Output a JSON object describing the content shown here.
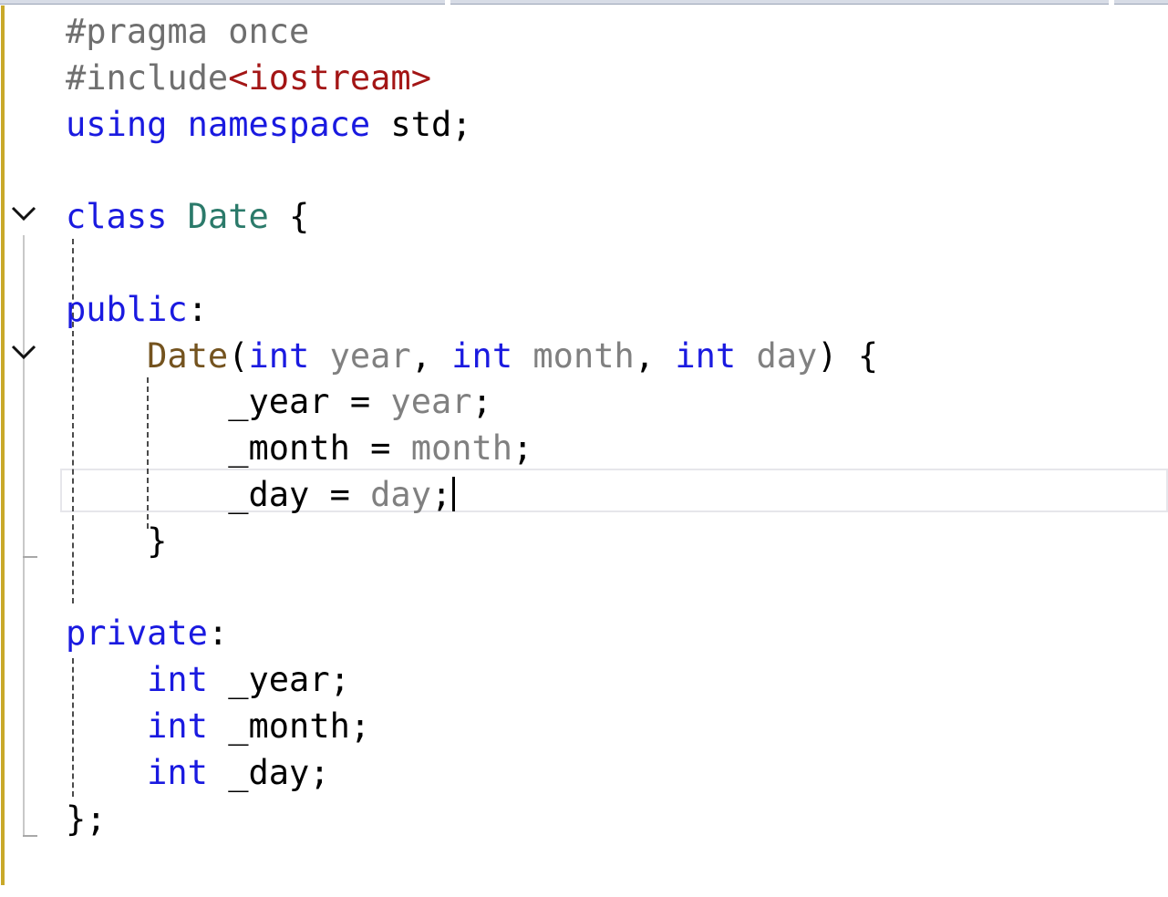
{
  "editor": {
    "language": "C++",
    "lines": [
      {
        "tokens": [
          {
            "t": "#pragma once",
            "c": "pre"
          }
        ]
      },
      {
        "tokens": [
          {
            "t": "#include",
            "c": "pre"
          },
          {
            "t": "<iostream>",
            "c": "inc"
          }
        ]
      },
      {
        "tokens": [
          {
            "t": "using",
            "c": "kw"
          },
          {
            "t": " ",
            "c": "punc"
          },
          {
            "t": "namespace",
            "c": "kw"
          },
          {
            "t": " std;",
            "c": "punc"
          }
        ]
      },
      {
        "tokens": []
      },
      {
        "tokens": [
          {
            "t": "class",
            "c": "kw"
          },
          {
            "t": " ",
            "c": "punc"
          },
          {
            "t": "Date",
            "c": "type"
          },
          {
            "t": " {",
            "c": "punc"
          }
        ]
      },
      {
        "tokens": []
      },
      {
        "tokens": [
          {
            "t": "public",
            "c": "kw"
          },
          {
            "t": ":",
            "c": "punc"
          }
        ]
      },
      {
        "tokens": [
          {
            "t": "    ",
            "c": "punc"
          },
          {
            "t": "Date",
            "c": "ctor"
          },
          {
            "t": "(",
            "c": "punc"
          },
          {
            "t": "int",
            "c": "kw"
          },
          {
            "t": " ",
            "c": "punc"
          },
          {
            "t": "year",
            "c": "param"
          },
          {
            "t": ", ",
            "c": "punc"
          },
          {
            "t": "int",
            "c": "kw"
          },
          {
            "t": " ",
            "c": "punc"
          },
          {
            "t": "month",
            "c": "param"
          },
          {
            "t": ", ",
            "c": "punc"
          },
          {
            "t": "int",
            "c": "kw"
          },
          {
            "t": " ",
            "c": "punc"
          },
          {
            "t": "day",
            "c": "param"
          },
          {
            "t": ") {",
            "c": "punc"
          }
        ]
      },
      {
        "tokens": [
          {
            "t": "        _year = ",
            "c": "mem"
          },
          {
            "t": "year",
            "c": "param"
          },
          {
            "t": ";",
            "c": "punc"
          }
        ]
      },
      {
        "tokens": [
          {
            "t": "        _month = ",
            "c": "mem"
          },
          {
            "t": "month",
            "c": "param"
          },
          {
            "t": ";",
            "c": "punc"
          }
        ]
      },
      {
        "tokens": [
          {
            "t": "        _day = ",
            "c": "mem"
          },
          {
            "t": "day",
            "c": "param"
          },
          {
            "t": ";",
            "c": "punc"
          }
        ],
        "caret": true
      },
      {
        "tokens": [
          {
            "t": "    }",
            "c": "punc"
          }
        ]
      },
      {
        "tokens": []
      },
      {
        "tokens": [
          {
            "t": "private",
            "c": "kw"
          },
          {
            "t": ":",
            "c": "punc"
          }
        ]
      },
      {
        "tokens": [
          {
            "t": "    ",
            "c": "punc"
          },
          {
            "t": "int",
            "c": "kw"
          },
          {
            "t": " _year;",
            "c": "mem"
          }
        ]
      },
      {
        "tokens": [
          {
            "t": "    ",
            "c": "punc"
          },
          {
            "t": "int",
            "c": "kw"
          },
          {
            "t": " _month;",
            "c": "mem"
          }
        ]
      },
      {
        "tokens": [
          {
            "t": "    ",
            "c": "punc"
          },
          {
            "t": "int",
            "c": "kw"
          },
          {
            "t": " _day;",
            "c": "mem"
          }
        ]
      },
      {
        "tokens": [
          {
            "t": "};",
            "c": "punc"
          }
        ]
      }
    ],
    "colors": {
      "keyword": "#1a1ae0",
      "type": "#2b7a6a",
      "constructor": "#74531f",
      "include_path": "#a31515",
      "preprocessor": "#6f6f6f",
      "parameter": "#808080",
      "change_margin": "#c9a92a"
    },
    "fold_icons": [
      "chevron-down-icon",
      "chevron-down-icon"
    ]
  }
}
